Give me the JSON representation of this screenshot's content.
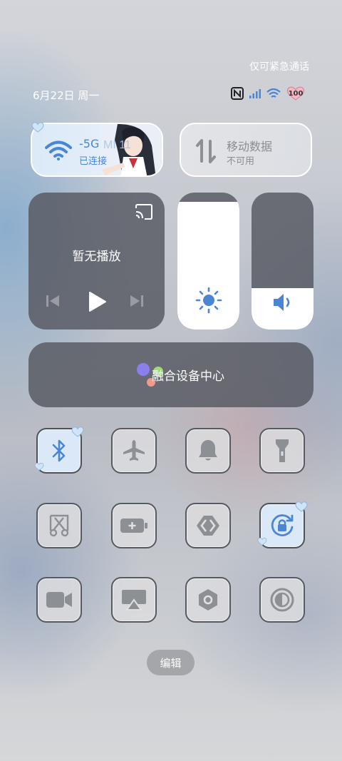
{
  "status_bar": {
    "emergency_text": "仅可紧急通话",
    "date_text": "6月22日 周一",
    "battery_level": "100",
    "icons": [
      "nfc-icon",
      "signal-icon",
      "wifi-icon",
      "battery-heart-icon"
    ]
  },
  "wifi_tile": {
    "ssid": "-5G",
    "status": "已连接",
    "art_text": "MI 11",
    "active": true
  },
  "mobile_data_tile": {
    "label": "移动数据",
    "status": "不可用",
    "active": false
  },
  "media": {
    "title": "暂无播放",
    "icons": [
      "cast-icon",
      "previous-icon",
      "play-icon",
      "next-icon"
    ]
  },
  "brightness": {
    "level": 0.93,
    "icon": "sun-icon"
  },
  "volume": {
    "level": 0.3,
    "icon": "speaker-icon"
  },
  "fusion": {
    "label": "融合设备中心",
    "colors": [
      "#8b7ff0",
      "#9fd87d",
      "#f29a8a"
    ]
  },
  "toggles": [
    {
      "name": "bluetooth",
      "icon": "bluetooth-icon",
      "active": true
    },
    {
      "name": "airplane-mode",
      "icon": "airplane-icon",
      "active": false
    },
    {
      "name": "ringer",
      "icon": "bell-icon",
      "active": false
    },
    {
      "name": "flashlight",
      "icon": "flashlight-icon",
      "active": false
    },
    {
      "name": "screenshot",
      "icon": "scissors-icon",
      "active": false
    },
    {
      "name": "battery-saver",
      "icon": "battery-plus-icon",
      "active": false
    },
    {
      "name": "link",
      "icon": "link-arrow-icon",
      "active": false
    },
    {
      "name": "rotation-lock",
      "icon": "rotation-lock-icon",
      "active": true
    },
    {
      "name": "screen-record",
      "icon": "video-camera-icon",
      "active": false
    },
    {
      "name": "screen-cast",
      "icon": "screen-cast-icon",
      "active": false
    },
    {
      "name": "settings",
      "icon": "hexagon-gear-icon",
      "active": false
    },
    {
      "name": "dark-mode",
      "icon": "contrast-icon",
      "active": false
    }
  ],
  "edit": {
    "label": "编辑"
  },
  "colors": {
    "accent_blue": "#4a86d4",
    "panel_dark": "#55585f",
    "toggle_icon_gray": "#8c8f94"
  }
}
